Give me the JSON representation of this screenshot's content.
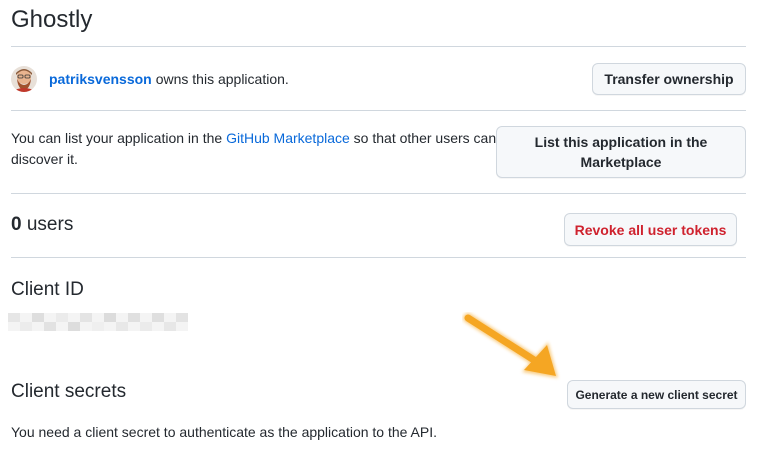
{
  "app": {
    "title": "Ghostly"
  },
  "owner": {
    "username": "patriksvensson",
    "suffix": "owns this application.",
    "transfer_label": "Transfer ownership"
  },
  "marketplace": {
    "text_before": "You can list your application in the ",
    "link_label": "GitHub Marketplace",
    "text_after": " so that other users can discover it.",
    "button_label": "List this application in the Marketplace"
  },
  "users": {
    "count": "0",
    "label": " users",
    "revoke_label": "Revoke all user tokens"
  },
  "client_id": {
    "heading": "Client ID"
  },
  "client_secrets": {
    "heading": "Client secrets",
    "generate_label": "Generate a new client secret",
    "description": "You need a client secret to authenticate as the application to the API."
  },
  "colors": {
    "link": "#0969da",
    "danger": "#cf222e",
    "border": "#d0d7de",
    "button_bg": "#f6f8fa",
    "arrow": "#f5a623"
  }
}
